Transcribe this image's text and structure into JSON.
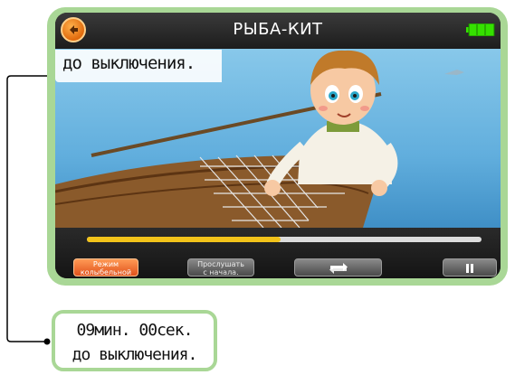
{
  "header": {
    "title": "РЫБА-КИТ",
    "back_icon": "back-arrow-icon",
    "battery_icon": "battery-icon"
  },
  "playback": {
    "progress": 0.49
  },
  "caption_on_screen": "до выключения.",
  "controls": {
    "lullaby_line1": "Режим",
    "lullaby_line2": "колыбельной",
    "replay_line1": "Прослушать",
    "replay_line2": "с начала.",
    "repeat_icon": "repeat-icon",
    "pause_icon": "pause-icon"
  },
  "callout": {
    "line1": "09мин. 00сек.",
    "line2": "до выключения."
  },
  "colors": {
    "frame": "#a9d796",
    "accent_orange": "#e8661a",
    "progress": "#f2c31a",
    "battery": "#35e000"
  }
}
